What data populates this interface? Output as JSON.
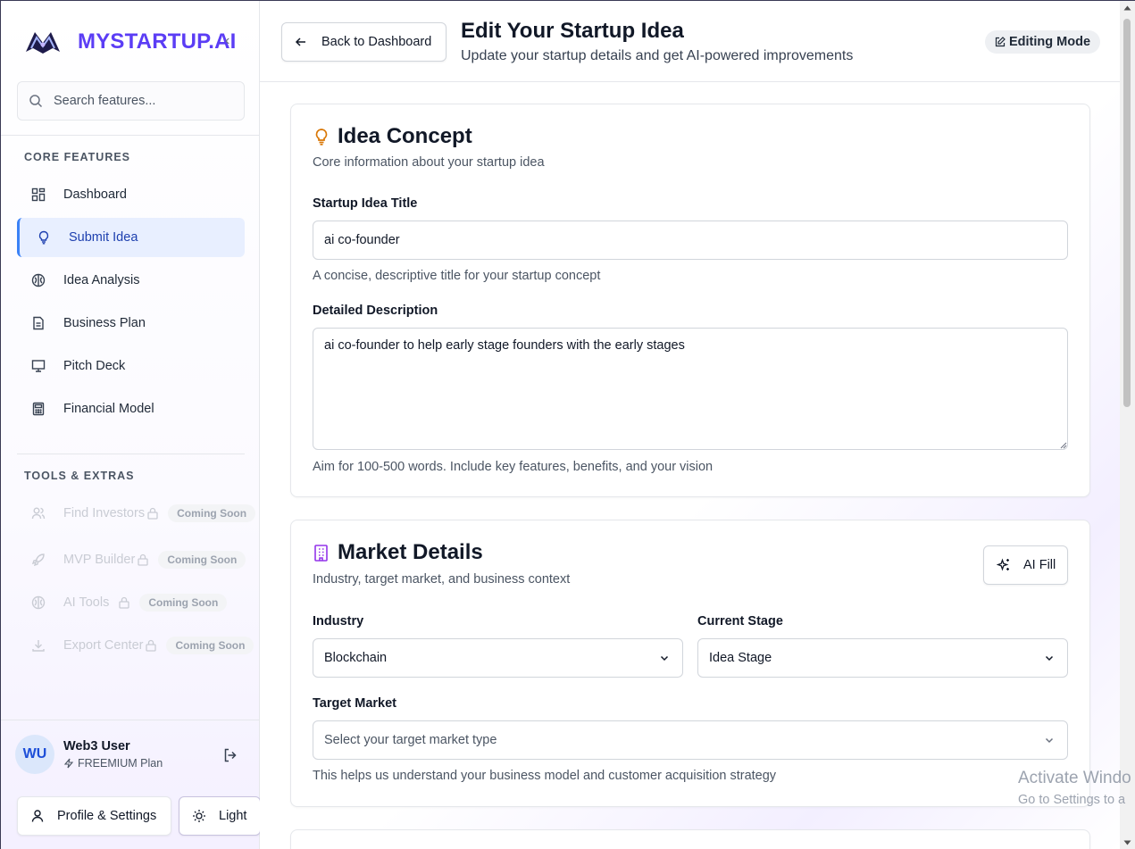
{
  "brand": {
    "name": "MYSTARTUP.AI"
  },
  "search": {
    "placeholder": "Search features..."
  },
  "sidebar": {
    "core_title": "CORE FEATURES",
    "core_items": [
      {
        "label": "Dashboard",
        "icon": "grid-icon"
      },
      {
        "label": "Submit Idea",
        "icon": "lightbulb-icon",
        "active": true
      },
      {
        "label": "Idea Analysis",
        "icon": "brain-icon"
      },
      {
        "label": "Business Plan",
        "icon": "document-icon"
      },
      {
        "label": "Pitch Deck",
        "icon": "presentation-icon"
      },
      {
        "label": "Financial Model",
        "icon": "calculator-icon"
      }
    ],
    "tools_title": "TOOLS & EXTRAS",
    "tools_items": [
      {
        "label": "Find Investors",
        "badge": "Coming Soon",
        "icon": "users-icon"
      },
      {
        "label": "MVP Builder",
        "badge": "Coming Soon",
        "icon": "rocket-icon"
      },
      {
        "label": "AI Tools",
        "badge": "Coming Soon",
        "icon": "brain-icon"
      },
      {
        "label": "Export Center",
        "badge": "Coming Soon",
        "icon": "download-icon"
      }
    ]
  },
  "user": {
    "initials": "WU",
    "name": "Web3 User",
    "plan": "FREEMIUM Plan"
  },
  "footer_buttons": {
    "profile": "Profile & Settings",
    "theme": "Light"
  },
  "header": {
    "back_label": "Back to Dashboard",
    "title": "Edit Your Startup Idea",
    "subtitle": "Update your startup details and get AI-powered improvements",
    "mode": "Editing Mode"
  },
  "idea_card": {
    "title": "Idea Concept",
    "subtitle": "Core information about your startup idea",
    "title_label": "Startup Idea Title",
    "title_value": "ai co-founder",
    "title_help": "A concise, descriptive title for your startup concept",
    "desc_label": "Detailed Description",
    "desc_value": "ai co-founder to help early stage founders with the early stages",
    "desc_help": "Aim for 100-500 words. Include key features, benefits, and your vision"
  },
  "market_card": {
    "title": "Market Details",
    "subtitle": "Industry, target market, and business context",
    "ai_fill": "AI Fill",
    "industry_label": "Industry",
    "industry_value": "Blockchain",
    "stage_label": "Current Stage",
    "stage_value": "Idea Stage",
    "target_label": "Target Market",
    "target_placeholder": "Select your target market type",
    "target_help": "This helps us understand your business model and customer acquisition strategy"
  },
  "watermark": {
    "line1": "Activate Windo",
    "line2": "Go to Settings to a"
  },
  "colors": {
    "brand": "#5b3df5",
    "active_bg": "#e8efff",
    "active_text": "#1e40af"
  }
}
